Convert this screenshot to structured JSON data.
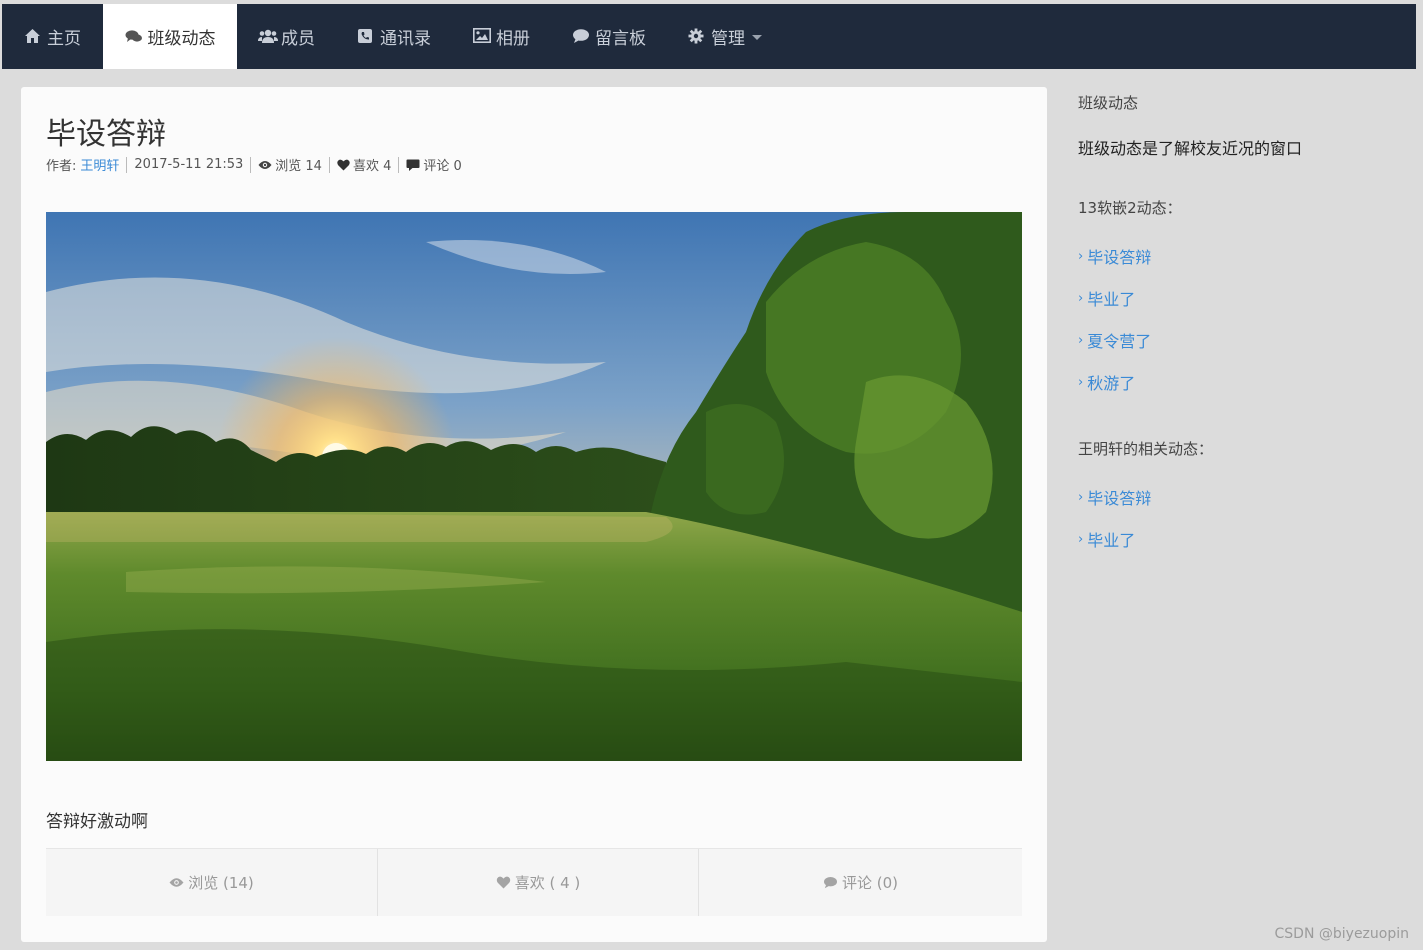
{
  "nav": {
    "items": [
      {
        "label": "主页",
        "icon": "home-icon"
      },
      {
        "label": "班级动态",
        "icon": "comments-icon"
      },
      {
        "label": "成员",
        "icon": "users-icon"
      },
      {
        "label": "通讯录",
        "icon": "phone-icon"
      },
      {
        "label": "相册",
        "icon": "picture-icon"
      },
      {
        "label": "留言板",
        "icon": "comment-icon"
      },
      {
        "label": "管理",
        "icon": "gear-icon"
      }
    ]
  },
  "post": {
    "title": "毕设答辩",
    "author_label": "作者:",
    "author": "王明轩",
    "date": "2017-5-11 21:53",
    "views_label": "浏览 14",
    "likes_label": "喜欢 4",
    "comments_label": "评论 0",
    "body": "答辩好激动啊"
  },
  "stats": {
    "views": "浏览 (14)",
    "likes": "喜欢 ( 4 )",
    "comments": "评论 (0)"
  },
  "sidebar": {
    "heading": "班级动态",
    "description": "班级动态是了解校友近况的窗口",
    "class_heading": "13软嵌2动态：",
    "class_links": [
      "毕设答辩",
      "毕业了",
      "夏令营了",
      "秋游了"
    ],
    "author_heading": "王明轩的相关动态：",
    "author_links": [
      "毕设答辩",
      "毕业了"
    ]
  },
  "watermark": "CSDN @biyezuopin",
  "colors": {
    "navbar": "#1f2a3c",
    "link": "#3a8ad6",
    "background": "#dcdcdc"
  }
}
